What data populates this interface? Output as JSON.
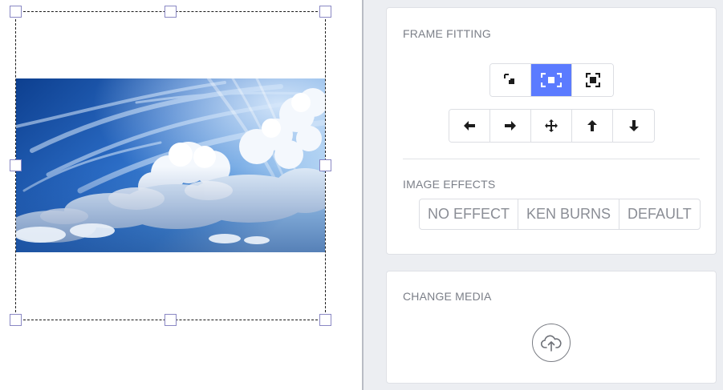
{
  "canvas": {
    "image_alt": "Blue sky with clouds"
  },
  "panel": {
    "frame_fitting": {
      "title": "FRAME FITTING",
      "fit_buttons": [
        {
          "name": "fit-top-left",
          "icon": "shrink-corner-icon",
          "active": false
        },
        {
          "name": "fit-center",
          "icon": "fit-frame-icon",
          "active": true
        },
        {
          "name": "fill-frame",
          "icon": "fill-frame-icon",
          "active": false
        }
      ],
      "move_buttons": [
        {
          "name": "move-left",
          "icon": "arrow-left-icon"
        },
        {
          "name": "move-right",
          "icon": "arrow-right-icon"
        },
        {
          "name": "move-center",
          "icon": "move-center-icon"
        },
        {
          "name": "move-up",
          "icon": "arrow-up-icon"
        },
        {
          "name": "move-down",
          "icon": "arrow-down-icon"
        }
      ]
    },
    "image_effects": {
      "title": "IMAGE EFFECTS",
      "options": [
        "NO EFFECT",
        "KEN BURNS",
        "DEFAULT"
      ]
    },
    "change_media": {
      "title": "CHANGE MEDIA",
      "upload_icon": "cloud-upload-icon"
    }
  },
  "colors": {
    "accent": "#5b7bff",
    "panel_bg": "#eceef2",
    "handle_border": "#8a88c4",
    "muted_text": "#7b7f88"
  }
}
